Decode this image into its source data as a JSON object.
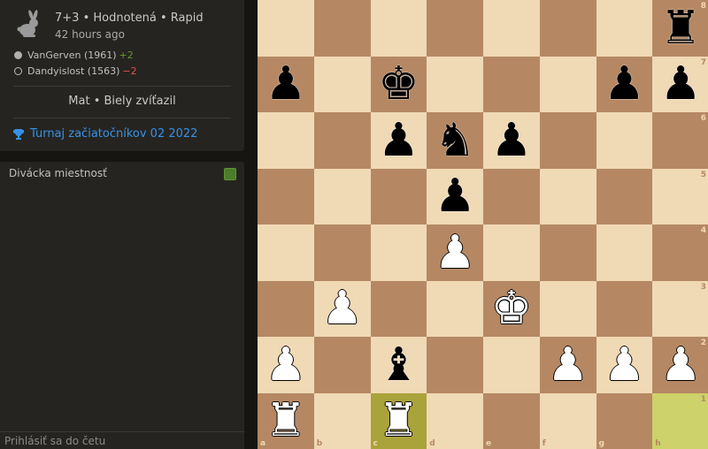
{
  "game": {
    "title": "7+3 • Hodnotená • Rapid",
    "time_ago": "42 hours ago",
    "variant_icon": "rabbit-icon",
    "players": [
      {
        "name": "VanGerven (1961)",
        "diff": "+2",
        "side": "white"
      },
      {
        "name": "Dandyislost (1563)",
        "diff": "−2",
        "side": "black"
      }
    ],
    "result": "Mat • Biely zvíťazil",
    "tournament": "Turnaj začiatočníkov 02 2022"
  },
  "chat": {
    "room_label": "Divácka miestnosť",
    "input_placeholder": "Prihlásiť sa do četu"
  },
  "colors": {
    "light_square": "#f0d9b5",
    "dark_square": "#b58863",
    "last_move_dark": "#aaa23a",
    "last_move_light": "#cdd26a",
    "link": "#3692e7"
  },
  "board": {
    "files": [
      "a",
      "b",
      "c",
      "d",
      "e",
      "f",
      "g",
      "h"
    ],
    "ranks": [
      "8",
      "7",
      "6",
      "5",
      "4",
      "3",
      "2",
      "1"
    ],
    "last_move": [
      "c1",
      "h1"
    ],
    "pieces": {
      "h8": "bR",
      "a7": "bP",
      "c7": "bK",
      "g7": "bP",
      "h7": "bP",
      "c6": "bP",
      "d6": "bN",
      "e6": "bP",
      "d5": "bP",
      "d4": "wP",
      "b3": "wP",
      "e3": "wK",
      "a2": "wP",
      "c2": "bB",
      "f2": "wP",
      "g2": "wP",
      "h2": "wP",
      "a1": "wR",
      "c1": "wR"
    }
  }
}
